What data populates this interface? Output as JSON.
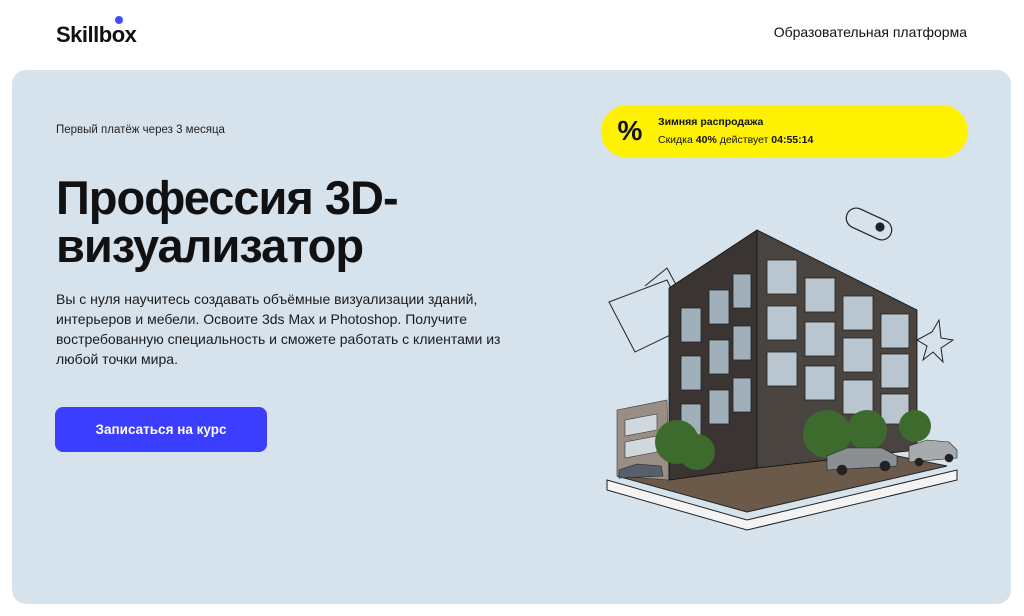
{
  "header": {
    "logo_text_a": "Skillb",
    "logo_text_b": "x",
    "logo_full": "Skillbox",
    "platform_link": "Образовательная платформа"
  },
  "hero": {
    "first_payment": "Первый платёж через 3 месяца",
    "title": "Профессия 3D-визуализатор",
    "description": "Вы с нуля научитесь создавать объёмные визуализации зданий, интерьеров и мебели. Освоите 3ds Max и Photoshop. Получите востребованную специальность и сможете работать с клиентами из любой точки мира.",
    "cta_label": "Записаться на курс"
  },
  "promo": {
    "icon": "%",
    "title": "Зимняя распродажа",
    "discount_prefix": "Скидка",
    "discount_value": "40%",
    "discount_suffix": "действует",
    "timer": "04:55:14"
  },
  "colors": {
    "hero_bg": "#d6e3ec",
    "cta_bg": "#3b3dff",
    "promo_bg": "#fff200",
    "logo_accent": "#3f4dff"
  }
}
